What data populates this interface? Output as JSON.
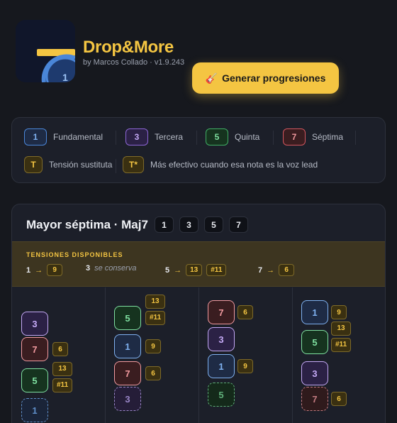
{
  "header": {
    "app_name": "Drop&More",
    "subtitle": "by Marcos Collado · v1.9.243",
    "generate_button": "Generar progresiones",
    "generate_icon": "guitar-icon",
    "logo_badge": "1"
  },
  "legend": {
    "items": [
      {
        "chip": "1",
        "label": "Fundamental",
        "type": "root"
      },
      {
        "chip": "3",
        "label": "Tercera",
        "type": "third"
      },
      {
        "chip": "5",
        "label": "Quinta",
        "type": "fifth"
      },
      {
        "chip": "7",
        "label": "Séptima",
        "type": "seventh"
      },
      {
        "chip": "T",
        "label": "Tensión sustituta",
        "type": "tension"
      },
      {
        "chip": "T*",
        "label": "Más efectivo cuando esa nota es la voz lead",
        "type": "tension-lead"
      }
    ]
  },
  "chord": {
    "title": "Mayor séptima · Maj7",
    "notes": [
      "1",
      "3",
      "5",
      "7"
    ],
    "tensions_title": "TENSIONES DISPONIBLES",
    "tensions": [
      {
        "from": "1",
        "to": [
          "9"
        ]
      },
      {
        "from": "3",
        "note": "se conserva"
      },
      {
        "from": "5",
        "to": [
          "13",
          "#11"
        ]
      },
      {
        "from": "7",
        "to": [
          "6"
        ]
      }
    ],
    "voicings": [
      [
        {
          "n": "3",
          "t": "third",
          "tensions": []
        },
        {
          "n": "7",
          "t": "seventh",
          "tensions": [
            "6"
          ]
        },
        {
          "n": "5",
          "t": "fifth",
          "tensions": [
            "13",
            "#11"
          ]
        },
        {
          "n": "1",
          "t": "root",
          "bass": true,
          "tensions": []
        }
      ],
      [
        {
          "n": "5",
          "t": "fifth",
          "tensions": [
            "13",
            "#11"
          ]
        },
        {
          "n": "1",
          "t": "root",
          "tensions": [
            "9"
          ]
        },
        {
          "n": "7",
          "t": "seventh",
          "tensions": [
            "6"
          ]
        },
        {
          "n": "3",
          "t": "third",
          "bass": true,
          "tensions": []
        }
      ],
      [
        {
          "n": "7",
          "t": "seventh",
          "tensions": [
            "6"
          ]
        },
        {
          "n": "3",
          "t": "third",
          "tensions": []
        },
        {
          "n": "1",
          "t": "root",
          "tensions": [
            "9"
          ]
        },
        {
          "n": "5",
          "t": "fifth",
          "bass": true,
          "tensions": []
        }
      ],
      [
        {
          "n": "1",
          "t": "root",
          "tensions": [
            "9"
          ]
        },
        {
          "n": "5",
          "t": "fifth",
          "tensions": [
            "13",
            "#11"
          ]
        },
        {
          "n": "3",
          "t": "third",
          "tensions": []
        },
        {
          "n": "7",
          "t": "seventh",
          "bass": true,
          "tensions": [
            "6"
          ]
        }
      ]
    ]
  },
  "colors": {
    "accent": "#f4c542",
    "root": "#4a86d8",
    "third": "#8d65d6",
    "fifth": "#3fae63",
    "seventh": "#d2555d"
  }
}
